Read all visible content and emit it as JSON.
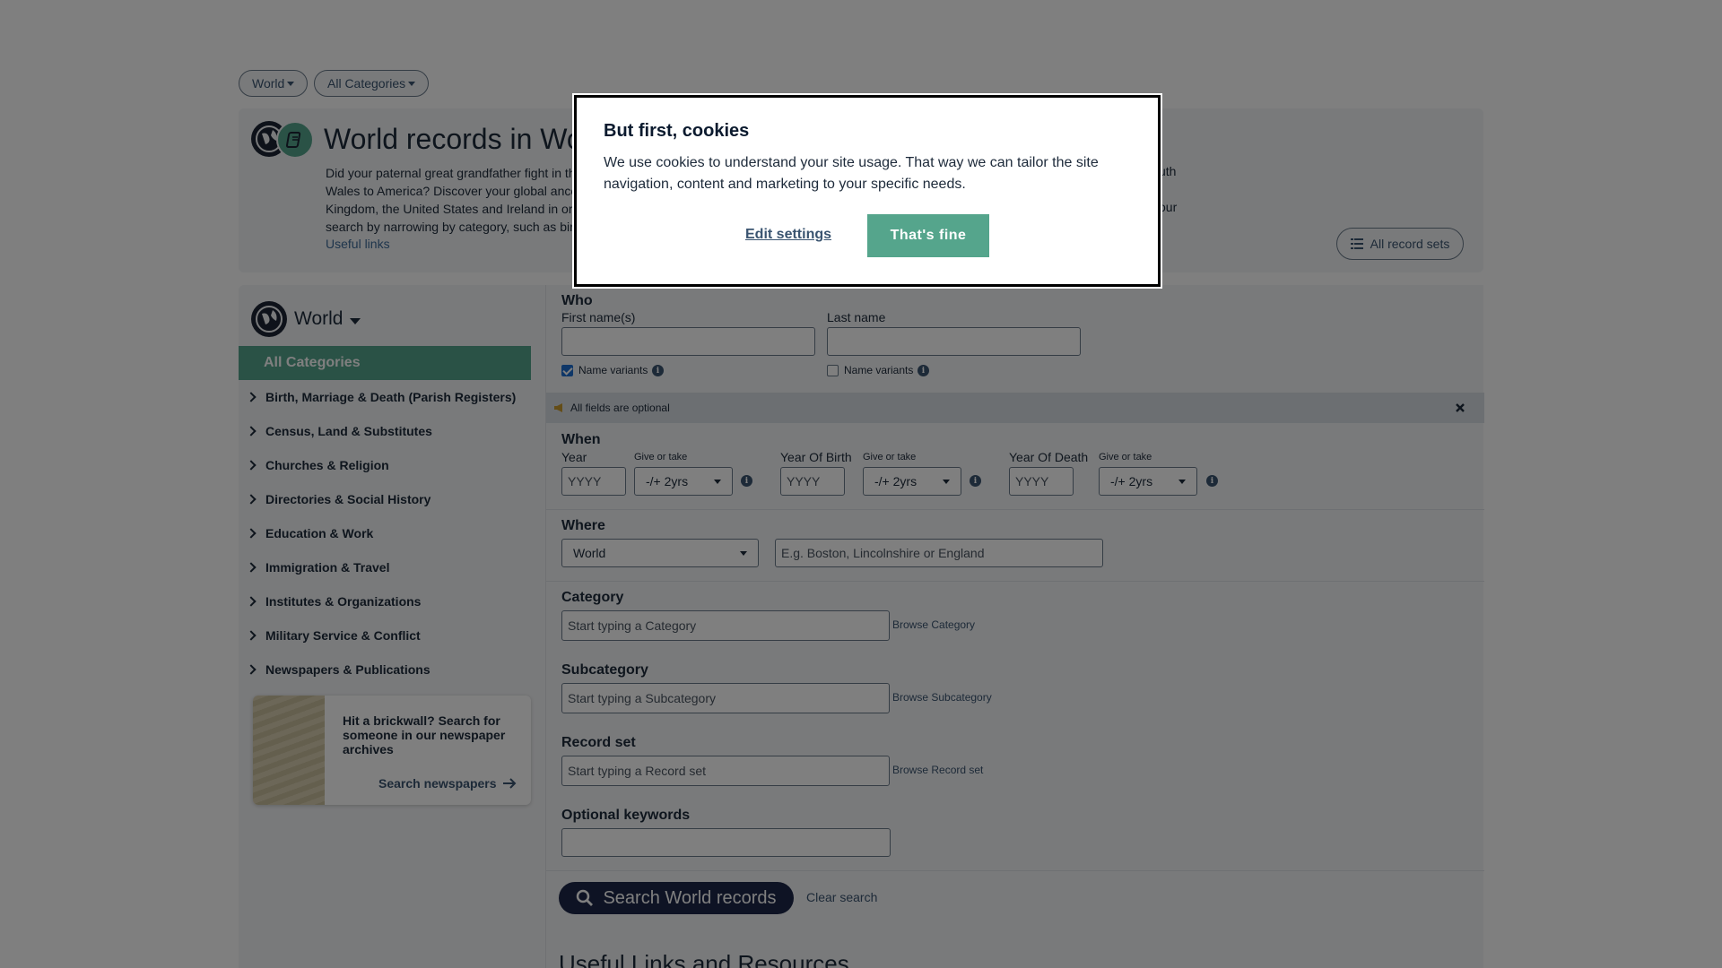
{
  "filters": {
    "region": "World",
    "category": "All Categories"
  },
  "hero": {
    "title": "World records in Wor",
    "text_lines": [
      "Did your paternal great grandfather fight in th",
      "Wales to America? Discover your global ance",
      "Kingdom, the United States and Ireland in or",
      "search by narrowing by category, such as bir"
    ],
    "text_right": [
      "uth",
      "our"
    ],
    "useful_links": "Useful links",
    "all_record_sets": "All record sets"
  },
  "sidebar": {
    "region_label": "World",
    "all_categories": "All Categories",
    "categories": [
      "Birth, Marriage & Death (Parish Registers)",
      "Census, Land & Substitutes",
      "Churches & Religion",
      "Directories & Social History",
      "Education & Work",
      "Immigration & Travel",
      "Institutes & Organizations",
      "Military Service & Conflict",
      "Newspapers & Publications"
    ],
    "promo": {
      "text": "Hit a brickwall? Search for someone in our newspaper archives",
      "link": "Search newspapers"
    }
  },
  "form": {
    "who": {
      "title": "Who",
      "first_label": "First name(s)",
      "last_label": "Last name",
      "first_value": "",
      "last_value": "",
      "variants_label": "Name variants",
      "first_variants_checked": true,
      "last_variants_checked": false
    },
    "optional_note": "All fields are optional",
    "when": {
      "title": "When",
      "year_label": "Year",
      "birth_label": "Year Of Birth",
      "death_label": "Year Of Death",
      "give_label": "Give or take",
      "year_placeholder": "YYYY",
      "range_value": "-/+ 2yrs"
    },
    "where": {
      "title": "Where",
      "region_value": "World",
      "place_placeholder": "E.g. Boston, Lincolnshire or England"
    },
    "category": {
      "title": "Category",
      "placeholder": "Start typing a Category",
      "browse": "Browse Category"
    },
    "subcategory": {
      "title": "Subcategory",
      "placeholder": "Start typing a Subcategory",
      "browse": "Browse Subcategory"
    },
    "recordset": {
      "title": "Record set",
      "placeholder": "Start typing a Record set",
      "browse": "Browse Record set"
    },
    "keywords": {
      "title": "Optional keywords",
      "value": ""
    },
    "search_button": "Search World records",
    "clear": "Clear search",
    "useful_heading": "Useful Links and Resources"
  },
  "cookie": {
    "title": "But first, cookies",
    "text": "We use cookies to understand your site usage. That way we can tailor the site navigation, content and marketing to your specific needs.",
    "edit": "Edit settings",
    "accept": "That's fine"
  },
  "colors": {
    "accent": "#55a58c",
    "dark": "#1c2748",
    "link": "#3a5470"
  }
}
